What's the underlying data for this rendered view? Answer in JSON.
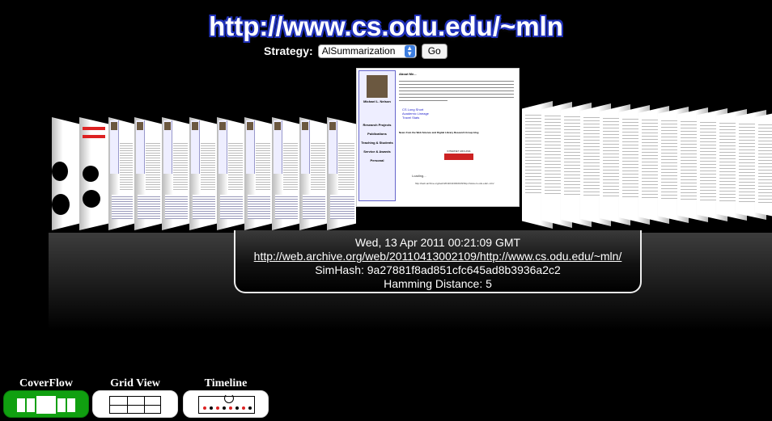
{
  "header": {
    "title": "http://www.cs.odu.edu/~mln",
    "strategy_label": "Strategy:",
    "strategy_value": "AlSummarization",
    "go_label": "Go"
  },
  "memento": {
    "datetime": "Wed, 13 Apr 2011 00:21:09 GMT",
    "uri": "http://web.archive.org/web/20110413002109/http://www.cs.odu.edu/~mln/",
    "simhash": "SimHash: 9a27881f8ad851cfc645ad8b3936a2c2",
    "hamming": "Hamming Distance: 5"
  },
  "center_page": {
    "heading": "About Me...",
    "name": "Michael L. Nelson",
    "nav": [
      "Research Projects",
      "Publications",
      "Teaching & Students",
      "Service & Awards",
      "Personal"
    ],
    "links": [
      "CS Long Short",
      "Academic Lineage",
      "Travel Stats"
    ],
    "lab_line": "News from the Web Science and Digital Library Research Group blog",
    "loading": "Loading...",
    "footer_link": "http://web.archive.org/web/20110413002109/http://www.cs.odu.edu/~mln/"
  },
  "views": {
    "coverflow": "CoverFlow",
    "grid": "Grid View",
    "timeline": "Timeline"
  },
  "colors": {
    "title_outline": "#2233bb",
    "active_view": "#10a010",
    "select_arrow": "#3d7ee0"
  }
}
